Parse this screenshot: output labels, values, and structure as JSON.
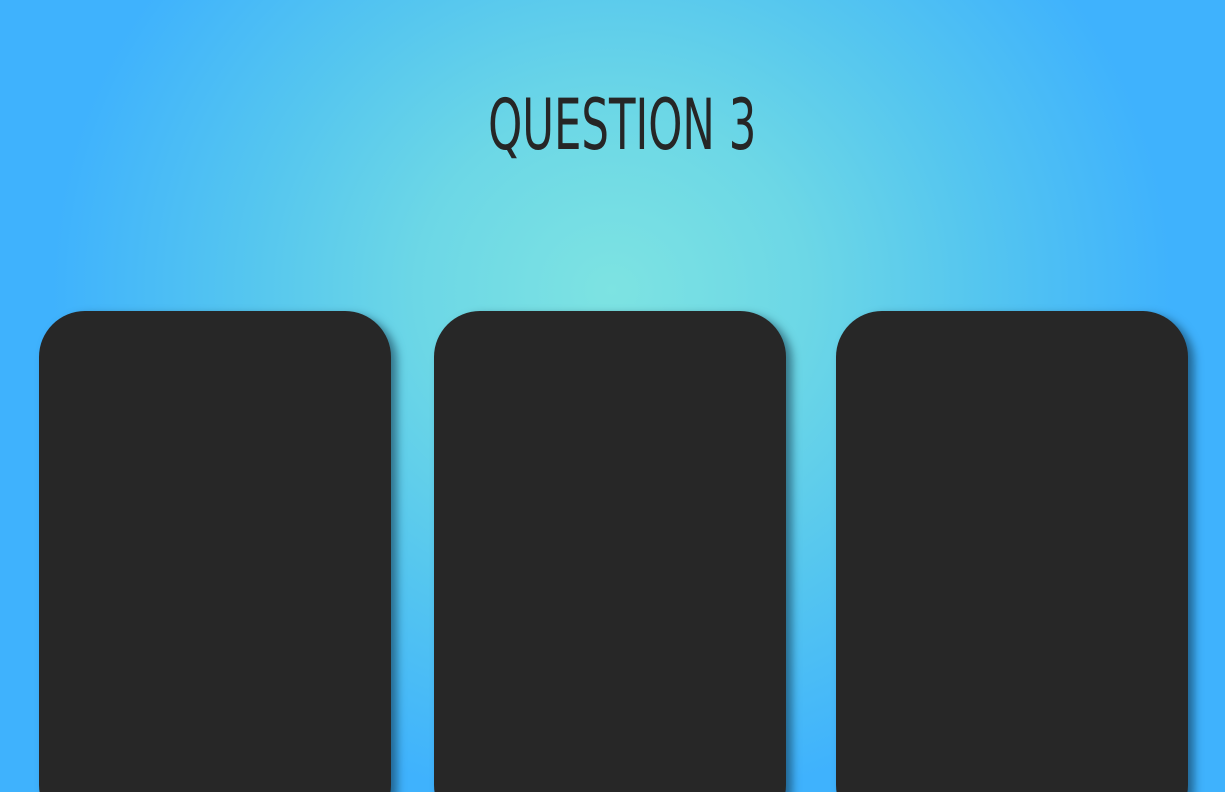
{
  "question": {
    "title": "QUESTION 3"
  },
  "colors": {
    "background_center": "#7de3e2",
    "background_edge": "#3fb2fd",
    "card": "#272727",
    "title_text": "#262626"
  },
  "cards": [
    {
      "label": ""
    },
    {
      "label": ""
    },
    {
      "label": ""
    }
  ]
}
